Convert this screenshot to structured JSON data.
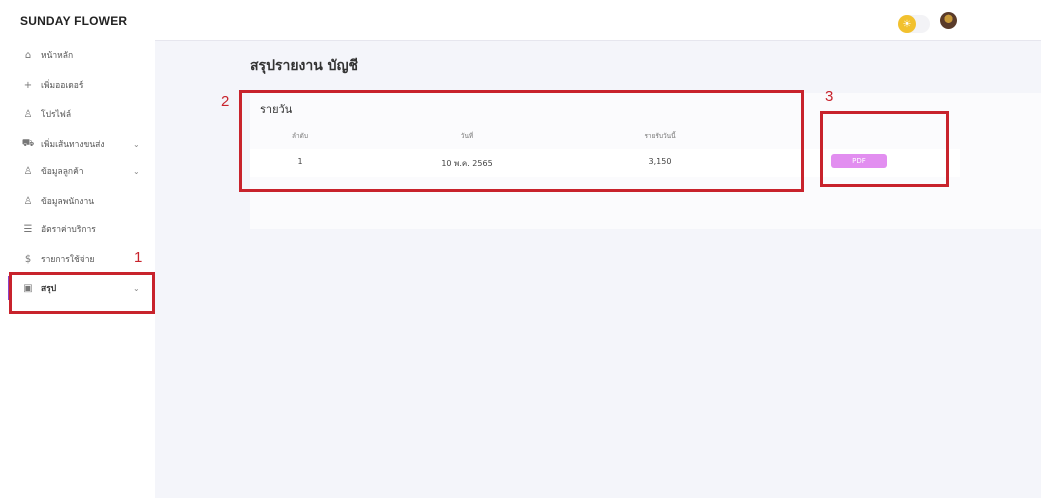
{
  "brand": "SUNDAY FLOWER",
  "sidebar": {
    "items": [
      {
        "label": "หน้าหลัก",
        "icon": "home-icon",
        "glyph": "⌂"
      },
      {
        "label": "เพิ่มออเดอร์",
        "icon": "plus-icon",
        "glyph": "+"
      },
      {
        "label": "โปรไฟล์",
        "icon": "user-icon",
        "glyph": "♙"
      },
      {
        "label": "เพิ่มเส้นทางขนส่ง",
        "icon": "truck-icon",
        "glyph": "⛟",
        "chevron": "⌄"
      },
      {
        "label": "ข้อมูลลูกค้า",
        "icon": "users-icon",
        "glyph": "♙",
        "chevron": "⌄"
      },
      {
        "label": "ข้อมูลพนักงาน",
        "icon": "staff-icon",
        "glyph": "♙"
      },
      {
        "label": "อัตราค่าบริการ",
        "icon": "list-icon",
        "glyph": "☰"
      },
      {
        "label": "รายการใช้จ่าย",
        "icon": "dollar-icon",
        "glyph": "$"
      },
      {
        "label": "สรุป",
        "icon": "report-icon",
        "glyph": "▣",
        "chevron": "⌄"
      }
    ]
  },
  "topbar": {
    "toggle_icon": "sun-icon",
    "toggle_glyph": "☀",
    "avatar_icon": "avatar"
  },
  "page": {
    "title": "สรุปรายงาน บัญชี"
  },
  "report": {
    "card_title": "รายวัน",
    "columns": [
      "ลำดับ",
      "วันที่",
      "รายรับวันนี้"
    ],
    "rows": [
      {
        "index": "1",
        "date": "10 พ.ค. 2565",
        "income": "3,150",
        "action": "PDF"
      }
    ]
  },
  "annotations": [
    "1",
    "2",
    "3"
  ],
  "colors": {
    "accent": "#8e44c8",
    "pdf_button": "#e28ef0",
    "annotation_red": "#c8232c",
    "toggle_sun": "#f2c12e"
  }
}
